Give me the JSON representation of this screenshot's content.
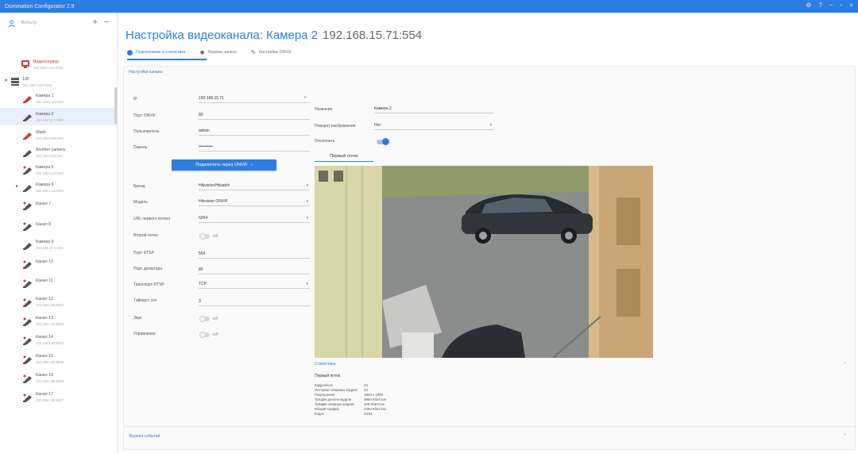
{
  "window": {
    "title": "Domination Configurator 2.9"
  },
  "sidebar": {
    "filter_placeholder": "Фильтр",
    "plus": "+",
    "minus": "−",
    "server": {
      "name": "Видеосервер",
      "sub": "192.168.0.104:7000"
    },
    "group": {
      "name": "130",
      "sub": "192.168.0.130:7000"
    },
    "items": [
      {
        "name": "Камера 1",
        "sub": "192.168.0.120:554"
      },
      {
        "name": "Камера 2",
        "sub": "192.168.15.71:554"
      },
      {
        "name": "Wash",
        "sub": "192.168.0.150:554"
      },
      {
        "name": "Another camera",
        "sub": "192.168.0.111:554"
      },
      {
        "name": "Камера 5",
        "sub": "192.168.0.140:554"
      },
      {
        "name": "Камера 6",
        "sub": "192.168.0.143:554"
      },
      {
        "name": "Канал 7",
        "sub": ""
      },
      {
        "name": "Канал 8",
        "sub": ""
      },
      {
        "name": "Камера 9",
        "sub": "192.168.15.71:554"
      },
      {
        "name": "Канал 10",
        "sub": ""
      },
      {
        "name": "Канал 11",
        "sub": ""
      },
      {
        "name": "Канал 12",
        "sub": "192.168.2.88:8002"
      },
      {
        "name": "Канал 13",
        "sub": "192.168.2.88:8003"
      },
      {
        "name": "Канал 14",
        "sub": "192.168.2.88:8004"
      },
      {
        "name": "Канал 15",
        "sub": "192.168.2.88:8005"
      },
      {
        "name": "Канал 16",
        "sub": "192.168.2.88:8006"
      },
      {
        "name": "Канал 17",
        "sub": "192.168.2.88:8007"
      }
    ]
  },
  "main": {
    "title": "Настройка видеоканала: Камера 2",
    "address": "192.168.15.71:554",
    "tabs": [
      {
        "label": "Подключение и статистика"
      },
      {
        "label": "Режимы записи"
      },
      {
        "label": "Настройки ONVIF"
      }
    ],
    "channel_panel_title": "Настройки канала",
    "form": {
      "ip_label": "IP",
      "ip_value": "192.168.15.71",
      "onvif_port_label": "Порт ONVIF",
      "onvif_port_value": "80",
      "user_label": "Пользователь",
      "user_value": "admin",
      "password_label": "Пароль",
      "password_value": "••••••••••",
      "onvif_button": "Подключить через ONVIF",
      "brand_label": "Бренд",
      "brand_value": "Hikvision/Hiwatch",
      "model_label": "Модель",
      "model_value": "Hikvision ONVIF",
      "url_label": "URL первого потока",
      "url_value": "h264",
      "second_stream_label": "Второй поток",
      "second_stream_value": "Off",
      "rtsp_port_label": "Порт RTSP",
      "rtsp_port_value": "554",
      "detector_port_label": "Порт детектора",
      "detector_port_value": "80",
      "transport_label": "Транспорт RTSP",
      "transport_value": "TCP",
      "timeout_label": "Таймаут, сек",
      "timeout_value": "3",
      "sound_label": "Звук",
      "sound_value": "Off",
      "control_label": "Управление",
      "control_value": "Off"
    },
    "right": {
      "name_label": "Название",
      "name_value": "Камера 2",
      "rotation_label": "Поворот изображения",
      "rotation_value": "Нет",
      "disable_label": "Отключить",
      "stream_tab": "Первый поток"
    },
    "stats": {
      "head": "Статистика",
      "title": "Первый поток",
      "rows": [
        {
          "k": "Кадров/сек",
          "v": "24"
        },
        {
          "k": "Интервал опорных кадров",
          "v": "24"
        },
        {
          "k": "Разрешение",
          "v": "1920 x 1080"
        },
        {
          "k": "Трафик дельта-кадров",
          "v": "3994 Кбит/сек"
        },
        {
          "k": "Трафик опорных кадров",
          "v": "409 Кбит/сек"
        },
        {
          "k": "Общий трафик",
          "v": "4403 Кбит/сек"
        },
        {
          "k": "Кодек",
          "v": "H264"
        }
      ]
    },
    "events_panel_title": "Журнал событий"
  },
  "colors": {
    "accent": "#2e7de1",
    "server_red": "#d23a3a"
  }
}
